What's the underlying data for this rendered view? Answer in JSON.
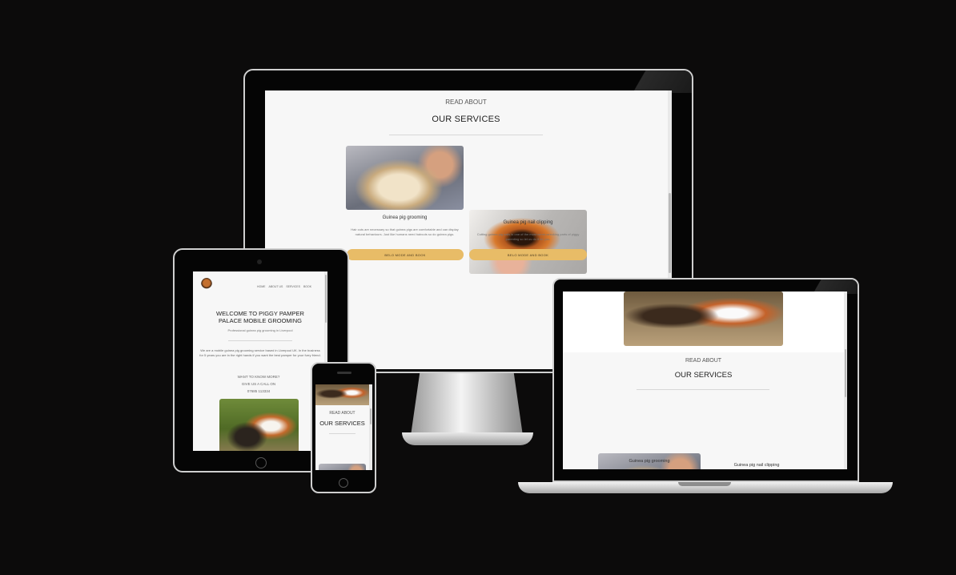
{
  "brand": {
    "accent": "#e8bc67",
    "screen_bg": "#f7f7f7",
    "canvas_bg": "#0c0b0b"
  },
  "desktop": {
    "eyebrow": "READ ABOUT",
    "heading": "OUR SERVICES",
    "cards": [
      {
        "title": "Guinea pig grooming",
        "body": "Hair cuts are necessary so that guinea pigs are comfortable and can display natural behaviours. Just like humans need haircuts so do guinea pigs.",
        "button": "BELO MODE AND BOOK",
        "icon": "guinea-pig-grooming-photo"
      },
      {
        "title": "Guinea pig nail clipping",
        "body": "Cutting guinea pig nails is one of the most nerve-wrecking parts of piggy parenting so let us do it for you.",
        "button": "BELO MODE AND BOOK",
        "icon": "guinea-pig-nail-clipping-photo"
      }
    ]
  },
  "tablet": {
    "nav": [
      "HOME",
      "ABOUT US",
      "SERVICES",
      "BOOK"
    ],
    "heading": "WELCOME TO PIGGY PAMPER PALACE MOBILE GROOMING",
    "subheading": "Professional guinea pig grooming in Liverpool",
    "intro": "We are a mobile guinea pig grooming service based in Liverpool UK. In the business for 5 years you are in the right hands if you want the best pamper for your furry friend.",
    "cta_line1": "WANT TO KNOW MORE?",
    "cta_line2": "GIVE US A CALL ON",
    "phone": "07685 113334"
  },
  "phone": {
    "eyebrow": "READ ABOUT",
    "heading": "OUR SERVICES"
  },
  "laptop": {
    "eyebrow": "READ ABOUT",
    "heading": "OUR SERVICES",
    "cards": [
      {
        "title": "Guinea pig grooming"
      },
      {
        "title": "Guinea pig nail clipping"
      }
    ]
  }
}
